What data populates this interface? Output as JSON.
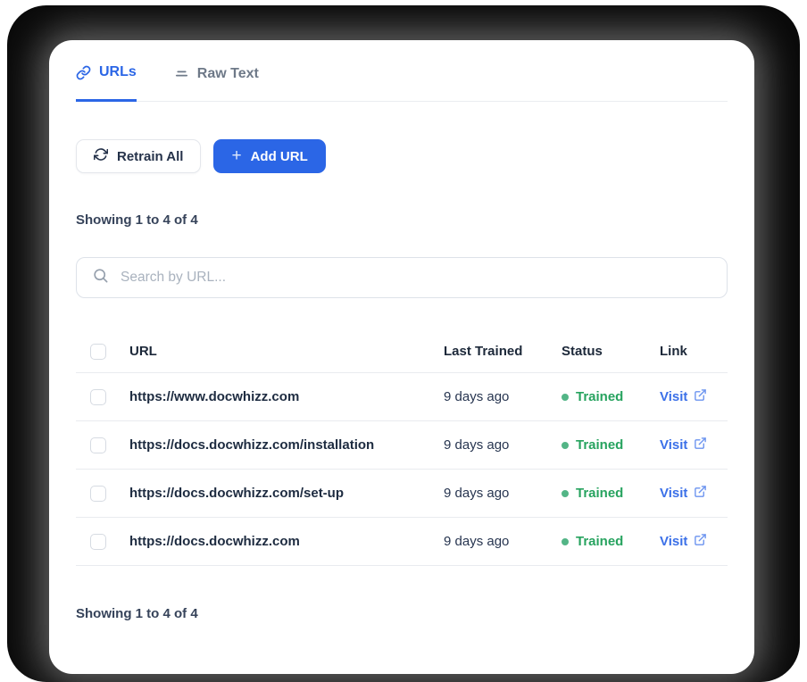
{
  "tabs": [
    {
      "label": "URLs",
      "icon": "link-icon",
      "active": true
    },
    {
      "label": "Raw Text",
      "icon": "text-lines-icon",
      "active": false
    }
  ],
  "toolbar": {
    "retrain_label": "Retrain All",
    "add_url_label": "Add URL",
    "plus_glyph": "+"
  },
  "summary": {
    "top": "Showing 1 to 4 of 4",
    "bottom": "Showing 1 to 4 of 4"
  },
  "search": {
    "placeholder": "Search by URL...",
    "value": ""
  },
  "table": {
    "columns": [
      "URL",
      "Last Trained",
      "Status",
      "Link"
    ],
    "rows": [
      {
        "url": "https://www.docwhizz.com",
        "last_trained": "9 days ago",
        "status": "Trained",
        "link_label": "Visit"
      },
      {
        "url": "https://docs.docwhizz.com/installation",
        "last_trained": "9 days ago",
        "status": "Trained",
        "link_label": "Visit"
      },
      {
        "url": "https://docs.docwhizz.com/set-up",
        "last_trained": "9 days ago",
        "status": "Trained",
        "link_label": "Visit"
      },
      {
        "url": "https://docs.docwhizz.com",
        "last_trained": "9 days ago",
        "status": "Trained",
        "link_label": "Visit"
      }
    ]
  },
  "colors": {
    "accent": "#2b66e6",
    "link-blue": "#3b70e8",
    "green": "#27a35f",
    "green-dot": "#53b586",
    "text-dark": "#1d2b40",
    "muted": "#6e7988"
  }
}
